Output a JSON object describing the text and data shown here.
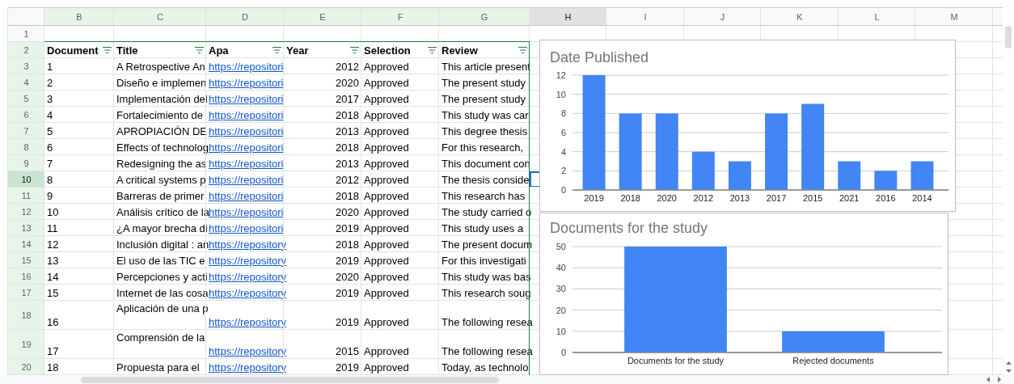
{
  "sheet": {
    "columns": [
      {
        "label": "B",
        "selected": false,
        "filtered": true
      },
      {
        "label": "C",
        "selected": false,
        "filtered": true
      },
      {
        "label": "D",
        "selected": false,
        "filtered": true
      },
      {
        "label": "E",
        "selected": false,
        "filtered": true
      },
      {
        "label": "F",
        "selected": false,
        "filtered": true
      },
      {
        "label": "G",
        "selected": false,
        "filtered": true
      },
      {
        "label": "H",
        "selected": true,
        "filtered": false
      },
      {
        "label": "I",
        "selected": false,
        "filtered": false
      },
      {
        "label": "J",
        "selected": false,
        "filtered": false
      },
      {
        "label": "K",
        "selected": false,
        "filtered": false
      },
      {
        "label": "L",
        "selected": false,
        "filtered": false
      },
      {
        "label": "M",
        "selected": false,
        "filtered": false
      }
    ],
    "blank_row": {
      "number": "1"
    },
    "header_row": {
      "number": "2",
      "headers": [
        "Document",
        "Title",
        "Apa",
        "Year",
        "Selection",
        "Review"
      ]
    },
    "rows": [
      {
        "number": "3",
        "selected": false,
        "wrap": false,
        "cells": [
          {
            "kind": "text",
            "text": "1"
          },
          {
            "kind": "text",
            "text": "A Retrospective An"
          },
          {
            "kind": "link",
            "text": "https://repositori"
          },
          {
            "kind": "number",
            "text": "2012"
          },
          {
            "kind": "text",
            "text": "Approved"
          },
          {
            "kind": "text",
            "text": "This article present"
          }
        ]
      },
      {
        "number": "4",
        "selected": false,
        "wrap": false,
        "cells": [
          {
            "kind": "text",
            "text": "2"
          },
          {
            "kind": "text",
            "text": "Diseño e implemen"
          },
          {
            "kind": "link",
            "text": "https://repositori"
          },
          {
            "kind": "number",
            "text": "2020"
          },
          {
            "kind": "text",
            "text": "Approved"
          },
          {
            "kind": "text",
            "text": "The present study"
          }
        ]
      },
      {
        "number": "5",
        "selected": false,
        "wrap": false,
        "cells": [
          {
            "kind": "text",
            "text": "3"
          },
          {
            "kind": "text",
            "text": "Implementación del"
          },
          {
            "kind": "link",
            "text": "https://repositori"
          },
          {
            "kind": "number",
            "text": "2017"
          },
          {
            "kind": "text",
            "text": "Approved"
          },
          {
            "kind": "text",
            "text": "The present study"
          }
        ]
      },
      {
        "number": "6",
        "selected": false,
        "wrap": false,
        "cells": [
          {
            "kind": "text",
            "text": "4"
          },
          {
            "kind": "text",
            "text": "Fortalecimiento de"
          },
          {
            "kind": "link",
            "text": "https://repositori"
          },
          {
            "kind": "number",
            "text": "2018"
          },
          {
            "kind": "text",
            "text": "Approved"
          },
          {
            "kind": "text",
            "text": "This study was car"
          }
        ]
      },
      {
        "number": "7",
        "selected": false,
        "wrap": false,
        "cells": [
          {
            "kind": "text",
            "text": "5"
          },
          {
            "kind": "text",
            "text": "APROPIACIÓN DE"
          },
          {
            "kind": "link",
            "text": "https://repositori"
          },
          {
            "kind": "number",
            "text": "2013"
          },
          {
            "kind": "text",
            "text": "Approved"
          },
          {
            "kind": "text",
            "text": "This degree thesis"
          }
        ]
      },
      {
        "number": "8",
        "selected": false,
        "wrap": false,
        "cells": [
          {
            "kind": "text",
            "text": "6"
          },
          {
            "kind": "text",
            "text": "Effects of technolog"
          },
          {
            "kind": "link",
            "text": "https://repositori"
          },
          {
            "kind": "number",
            "text": "2018"
          },
          {
            "kind": "text",
            "text": "Approved"
          },
          {
            "kind": "text",
            "text": "For this research,"
          }
        ]
      },
      {
        "number": "9",
        "selected": false,
        "wrap": false,
        "cells": [
          {
            "kind": "text",
            "text": "7"
          },
          {
            "kind": "text",
            "text": "Redesigning the as"
          },
          {
            "kind": "link",
            "text": "https://repositori"
          },
          {
            "kind": "number",
            "text": "2013"
          },
          {
            "kind": "text",
            "text": "Approved"
          },
          {
            "kind": "text",
            "text": "This document con"
          }
        ]
      },
      {
        "number": "10",
        "selected": true,
        "wrap": false,
        "cells": [
          {
            "kind": "text",
            "text": "8"
          },
          {
            "kind": "text",
            "text": "A critical systems p"
          },
          {
            "kind": "link",
            "text": "https://repositori"
          },
          {
            "kind": "number",
            "text": "2012"
          },
          {
            "kind": "text",
            "text": "Approved"
          },
          {
            "kind": "text",
            "text": "The thesis conside"
          }
        ]
      },
      {
        "number": "11",
        "selected": false,
        "wrap": false,
        "cells": [
          {
            "kind": "text",
            "text": "9"
          },
          {
            "kind": "text",
            "text": "Barreras de primer"
          },
          {
            "kind": "link",
            "text": "https://repositori"
          },
          {
            "kind": "number",
            "text": "2018"
          },
          {
            "kind": "text",
            "text": "Approved"
          },
          {
            "kind": "text",
            "text": "This research has"
          }
        ]
      },
      {
        "number": "12",
        "selected": false,
        "wrap": false,
        "cells": [
          {
            "kind": "text",
            "text": "10"
          },
          {
            "kind": "text",
            "text": "Análisis crítico de la"
          },
          {
            "kind": "link",
            "text": "https://repositori"
          },
          {
            "kind": "number",
            "text": "2020"
          },
          {
            "kind": "text",
            "text": "Approved"
          },
          {
            "kind": "text",
            "text": "The study carried o"
          }
        ]
      },
      {
        "number": "13",
        "selected": false,
        "wrap": false,
        "cells": [
          {
            "kind": "text",
            "text": "11"
          },
          {
            "kind": "text",
            "text": "¿A mayor brecha di"
          },
          {
            "kind": "link",
            "text": "https://repositori"
          },
          {
            "kind": "number",
            "text": "2019"
          },
          {
            "kind": "text",
            "text": "Approved"
          },
          {
            "kind": "text",
            "text": "This study uses a"
          }
        ]
      },
      {
        "number": "14",
        "selected": false,
        "wrap": false,
        "cells": [
          {
            "kind": "text",
            "text": "12"
          },
          {
            "kind": "text",
            "text": "Inclusión digital : an"
          },
          {
            "kind": "link",
            "text": "https://repository"
          },
          {
            "kind": "number",
            "text": "2018"
          },
          {
            "kind": "text",
            "text": "Approved"
          },
          {
            "kind": "text",
            "text": "The present docum"
          }
        ]
      },
      {
        "number": "15",
        "selected": false,
        "wrap": false,
        "cells": [
          {
            "kind": "text",
            "text": "13"
          },
          {
            "kind": "text",
            "text": "El uso de las TIC e"
          },
          {
            "kind": "link",
            "text": "https://repository"
          },
          {
            "kind": "number",
            "text": "2019"
          },
          {
            "kind": "text",
            "text": "Approved"
          },
          {
            "kind": "text",
            "text": "For this investigati"
          }
        ]
      },
      {
        "number": "16",
        "selected": false,
        "wrap": false,
        "cells": [
          {
            "kind": "text",
            "text": "14"
          },
          {
            "kind": "text",
            "text": "Percepciones y acti"
          },
          {
            "kind": "link",
            "text": "https://repository"
          },
          {
            "kind": "number",
            "text": "2020"
          },
          {
            "kind": "text",
            "text": "Approved"
          },
          {
            "kind": "text",
            "text": "This study was bas"
          }
        ]
      },
      {
        "number": "17",
        "selected": false,
        "wrap": false,
        "cells": [
          {
            "kind": "text",
            "text": "15"
          },
          {
            "kind": "text",
            "text": "Internet de las cosa"
          },
          {
            "kind": "link",
            "text": "https://repository"
          },
          {
            "kind": "number",
            "text": "2019"
          },
          {
            "kind": "text",
            "text": "Approved"
          },
          {
            "kind": "text",
            "text": "This research soug"
          }
        ]
      },
      {
        "number": "18",
        "selected": false,
        "wrap": true,
        "cells": [
          {
            "kind": "text",
            "text": "16"
          },
          {
            "kind": "text",
            "text": "Aplicación de una p"
          },
          {
            "kind": "link",
            "text": "https://repository"
          },
          {
            "kind": "number",
            "text": "2019"
          },
          {
            "kind": "text",
            "text": "Approved"
          },
          {
            "kind": "text",
            "text": "The following resea"
          }
        ]
      },
      {
        "number": "19",
        "selected": false,
        "wrap": true,
        "cells": [
          {
            "kind": "text",
            "text": "17"
          },
          {
            "kind": "text",
            "text": "Comprensión de la"
          },
          {
            "kind": "link",
            "text": "https://repository"
          },
          {
            "kind": "number",
            "text": "2015"
          },
          {
            "kind": "text",
            "text": "Approved"
          },
          {
            "kind": "text",
            "text": "The following resea"
          }
        ]
      },
      {
        "number": "20",
        "selected": false,
        "wrap": false,
        "cells": [
          {
            "kind": "text",
            "text": "18"
          },
          {
            "kind": "text",
            "text": "Propuesta para el"
          },
          {
            "kind": "link",
            "text": "https://repository"
          },
          {
            "kind": "number",
            "text": "2019"
          },
          {
            "kind": "text",
            "text": "Approved"
          },
          {
            "kind": "text",
            "text": "Today, as technolo"
          }
        ]
      }
    ]
  },
  "charts": [
    {
      "chart_data": {
        "type": "bar",
        "title": "Date Published",
        "categories": [
          "2019",
          "2018",
          "2020",
          "2012",
          "2013",
          "2017",
          "2015",
          "2021",
          "2016",
          "2014"
        ],
        "series": [
          {
            "color": "#4285f4",
            "values": [
              12,
              8,
              8,
              4,
              3,
              8,
              9,
              3,
              2,
              3
            ]
          }
        ],
        "grid": true,
        "ylim": [
          0,
          12
        ],
        "yticks": [
          0,
          2,
          4,
          6,
          8,
          10,
          12
        ]
      }
    },
    {
      "chart_data": {
        "type": "bar",
        "title": "Documents for the study",
        "categories": [
          "Documents for the study",
          "Rejected documents"
        ],
        "series": [
          {
            "color": "#4285f4",
            "values": [
              50,
              10
            ]
          }
        ],
        "grid": true,
        "ylim": [
          0,
          50
        ],
        "yticks": [
          0,
          10,
          20,
          30,
          40,
          50
        ]
      }
    }
  ]
}
